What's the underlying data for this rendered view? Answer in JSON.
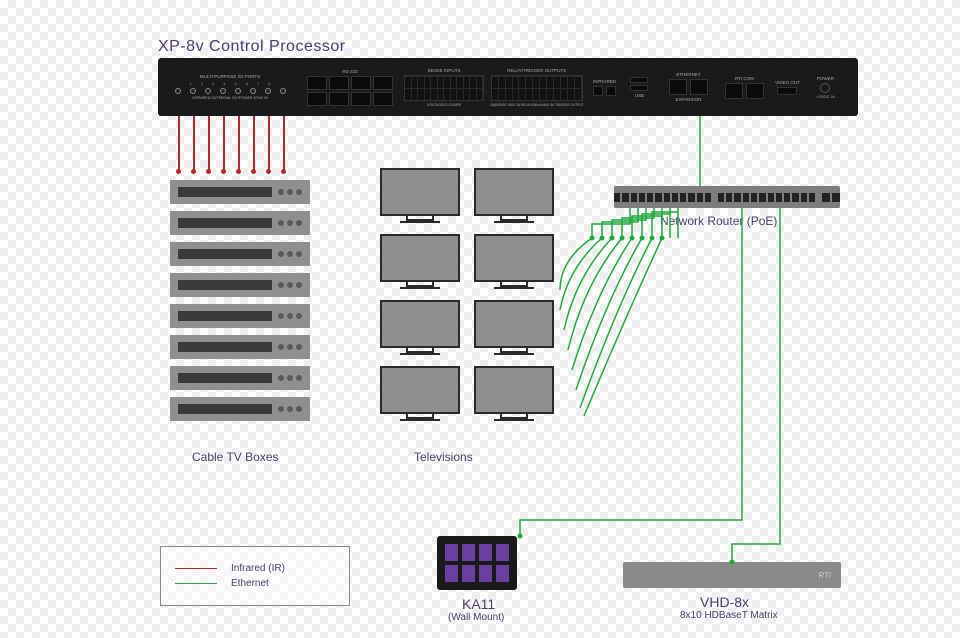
{
  "title": "XP-8v Control Processor",
  "processor": {
    "sections": {
      "io": "MULTI-PURPOSE I/O PORTS",
      "io_sub": "INFRARED   OUTSERIAL OUTPOWER SYNC IN",
      "rs232": "RS-232",
      "sense": "SENSE INPUTS",
      "sense_sub": "VOLTAGE/CLOSURE",
      "relay": "RELAY/TRIGGER OUTPUTS",
      "relay_sub": "3A@30VDC MAX  3A RELAY/150mA MAX  3A TRIGGER OUTPUT",
      "infrared": "INFRARED",
      "usb": "USB",
      "ethernet": "ETHERNET",
      "expansion": "EXPANSION",
      "rticom": "RTI  COM",
      "video": "VIDEO  OUT",
      "power": "POWER",
      "power_sub": "+12VDC 1A"
    }
  },
  "labels": {
    "cable_boxes": "Cable TV Boxes",
    "televisions": "Televisions",
    "router": "Network Router (PoE)",
    "ka11_title": "KA11",
    "ka11_sub": "(Wall Mount)",
    "vhd_title": "VHD-8x",
    "vhd_sub": "8x10 HDBaseT Matrix",
    "vhd_brand": "RTI"
  },
  "legend": {
    "infrared": "Infrared (IR)",
    "ethernet": "Ethernet"
  },
  "counts": {
    "io_ports": 8,
    "cable_boxes": 8,
    "televisions": 8,
    "router_ports": 26,
    "ka11_pads": 8
  }
}
